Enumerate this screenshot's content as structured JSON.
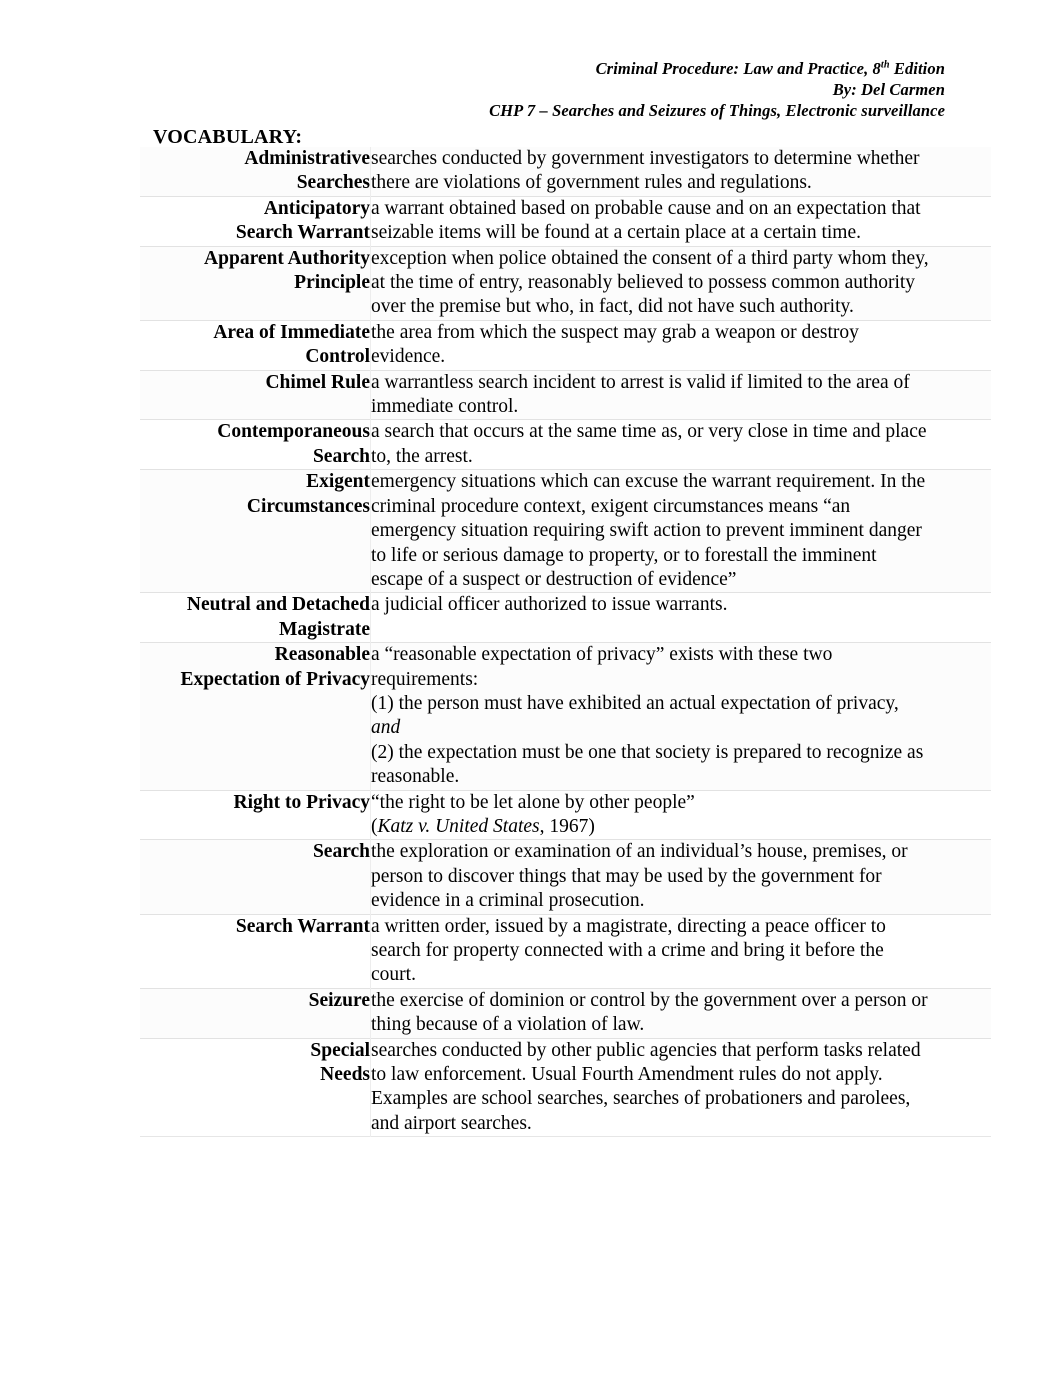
{
  "header": {
    "line1_prefix": "Criminal Procedure: Law and Practice, 8",
    "line1_sup": "th",
    "line1_suffix": " Edition",
    "line2": "By: Del Carmen",
    "line3": "CHP 7 – Searches and Seizures of Things, Electronic surveillance"
  },
  "section": {
    "title": "VOCABULARY:"
  },
  "table": {
    "rows": [
      {
        "term_lines": [
          "Administrative",
          "Searches"
        ],
        "def_lines": [
          [
            {
              "t": "searches conducted by government investigators to determine whether",
              "i": false
            }
          ],
          [
            {
              "t": "there are violations of government rules and regulations.",
              "i": false
            }
          ]
        ]
      },
      {
        "term_lines": [
          "Anticipatory",
          "Search Warrant"
        ],
        "def_lines": [
          [
            {
              "t": "a warrant obtained based on probable cause and on an expectation that",
              "i": false
            }
          ],
          [
            {
              "t": "seizable items will be found at a certain place at a certain time.",
              "i": false
            }
          ]
        ]
      },
      {
        "term_lines": [
          "Apparent Authority",
          "Principle"
        ],
        "def_lines": [
          [
            {
              "t": "exception when police obtained the consent of a third party whom they,",
              "i": false
            }
          ],
          [
            {
              "t": "at the time of entry, reasonably believed to possess common authority",
              "i": false
            }
          ],
          [
            {
              "t": "over the premise but who, in fact, did not have such authority.",
              "i": false
            }
          ]
        ]
      },
      {
        "term_lines": [
          "Area of Immediate",
          "Control"
        ],
        "def_lines": [
          [
            {
              "t": "the area from which the suspect may grab a weapon or destroy",
              "i": false
            }
          ],
          [
            {
              "t": "evidence.",
              "i": false
            }
          ]
        ]
      },
      {
        "term_lines": [
          "Chimel Rule"
        ],
        "def_lines": [
          [
            {
              "t": "a warrantless search incident to arrest is valid if limited to the area of",
              "i": false
            }
          ],
          [
            {
              "t": "immediate control.",
              "i": false
            }
          ]
        ]
      },
      {
        "term_lines": [
          "Contemporaneous",
          "Search"
        ],
        "def_lines": [
          [
            {
              "t": "a search that occurs at the same time as, or very close in time and place",
              "i": false
            }
          ],
          [
            {
              "t": "to, the arrest.",
              "i": false
            }
          ]
        ]
      },
      {
        "term_lines": [
          "Exigent",
          "Circumstances"
        ],
        "def_lines": [
          [
            {
              "t": "emergency situations which can excuse the warrant requirement.  In the",
              "i": false
            }
          ],
          [
            {
              "t": "criminal procedure context, exigent circumstances means “an",
              "i": false
            }
          ],
          [
            {
              "t": "emergency situation requiring swift action to prevent imminent danger",
              "i": false
            }
          ],
          [
            {
              "t": "to life or serious damage to property, or to forestall the imminent",
              "i": false
            }
          ],
          [
            {
              "t": "escape of a suspect or destruction of evidence”",
              "i": false
            }
          ]
        ]
      },
      {
        "term_lines": [
          "Neutral and Detached",
          "Magistrate"
        ],
        "def_lines": [
          [
            {
              "t": "a judicial officer authorized to issue warrants.",
              "i": false
            }
          ]
        ]
      },
      {
        "term_lines": [
          "Reasonable",
          "Expectation of Privacy"
        ],
        "def_lines": [
          [
            {
              "t": "a “reasonable expectation of privacy” exists with these two",
              "i": false
            }
          ],
          [
            {
              "t": "requirements:",
              "i": false
            }
          ],
          [
            {
              "t": "(1) the person must have exhibited an actual expectation of privacy,",
              "i": false
            }
          ],
          [
            {
              "t": "and",
              "i": true
            }
          ],
          [
            {
              "t": "(2) the expectation must be one that society is prepared to recognize as",
              "i": false
            }
          ],
          [
            {
              "t": "reasonable.",
              "i": false
            }
          ]
        ]
      },
      {
        "term_lines": [
          "Right to Privacy"
        ],
        "def_lines": [
          [
            {
              "t": "“the right to be let alone by other people”",
              "i": false
            }
          ],
          [
            {
              "t": "(",
              "i": false
            },
            {
              "t": "Katz v. United States",
              "i": true
            },
            {
              "t": ", 1967)",
              "i": false
            }
          ]
        ]
      },
      {
        "term_lines": [
          "Search"
        ],
        "def_lines": [
          [
            {
              "t": "the exploration or examination of an individual’s house, premises, or",
              "i": false
            }
          ],
          [
            {
              "t": "person to discover things that may be used by the government for",
              "i": false
            }
          ],
          [
            {
              "t": "evidence in a criminal prosecution.",
              "i": false
            }
          ]
        ]
      },
      {
        "term_lines": [
          "Search Warrant"
        ],
        "def_lines": [
          [
            {
              "t": "a written order, issued by a magistrate, directing a peace officer to",
              "i": false
            }
          ],
          [
            {
              "t": "search for property connected with a crime and bring it before the",
              "i": false
            }
          ],
          [
            {
              "t": "court.",
              "i": false
            }
          ]
        ]
      },
      {
        "term_lines": [
          "Seizure"
        ],
        "def_lines": [
          [
            {
              "t": "the exercise of dominion or control by the government over a person or",
              "i": false
            }
          ],
          [
            {
              "t": "thing because of a violation of law.",
              "i": false
            }
          ]
        ]
      },
      {
        "term_lines": [
          "Special",
          "Needs"
        ],
        "def_lines": [
          [
            {
              "t": "searches conducted by other public agencies that perform tasks related",
              "i": false
            }
          ],
          [
            {
              "t": "to law enforcement.  Usual Fourth Amendment rules do not apply.",
              "i": false
            }
          ],
          [
            {
              "t": "Examples are school searches, searches of probationers and parolees,",
              "i": false
            }
          ],
          [
            {
              "t": "and airport searches.",
              "i": false
            }
          ]
        ]
      }
    ]
  }
}
